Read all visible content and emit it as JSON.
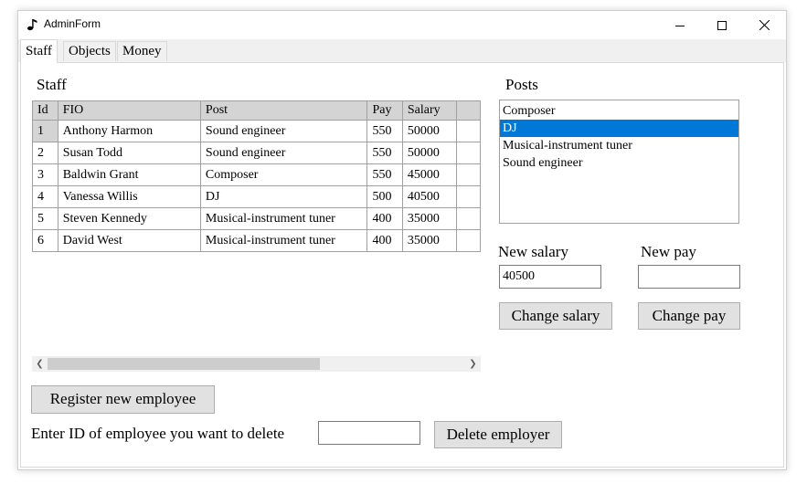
{
  "window": {
    "title": "AdminForm"
  },
  "tabs": [
    {
      "label": "Staff",
      "active": true
    },
    {
      "label": "Objects",
      "active": false
    },
    {
      "label": "Money",
      "active": false
    }
  ],
  "staff": {
    "label": "Staff",
    "columns": [
      "Id",
      "FIO",
      "Post",
      "Pay",
      "Salary"
    ],
    "rows": [
      [
        "1",
        "Anthony Harmon",
        "Sound engineer",
        "550",
        "50000"
      ],
      [
        "2",
        "Susan Todd",
        "Sound engineer",
        "550",
        "50000"
      ],
      [
        "3",
        "Baldwin Grant",
        "Composer",
        "550",
        "45000"
      ],
      [
        "4",
        "Vanessa Willis",
        "DJ",
        "500",
        "40500"
      ],
      [
        "5",
        "Steven Kennedy",
        "Musical-instrument tuner",
        "400",
        "35000"
      ],
      [
        "6",
        "David West",
        "Musical-instrument tuner",
        "400",
        "35000"
      ]
    ]
  },
  "posts": {
    "label": "Posts",
    "items": [
      "Composer",
      "DJ",
      "Musical-instrument tuner",
      "Sound engineer"
    ],
    "selected": "DJ"
  },
  "salary": {
    "label": "New salary",
    "value": "40500",
    "button": "Change salary"
  },
  "pay": {
    "label": "New pay",
    "value": "",
    "button": "Change pay"
  },
  "register_button": "Register new employee",
  "delete": {
    "label": "Enter ID of employee you want to delete",
    "value": "",
    "button": "Delete employer"
  },
  "colors": {
    "selection": "#0078d7",
    "header_bg": "#d4d4d4",
    "button_bg": "#e1e1e1"
  }
}
